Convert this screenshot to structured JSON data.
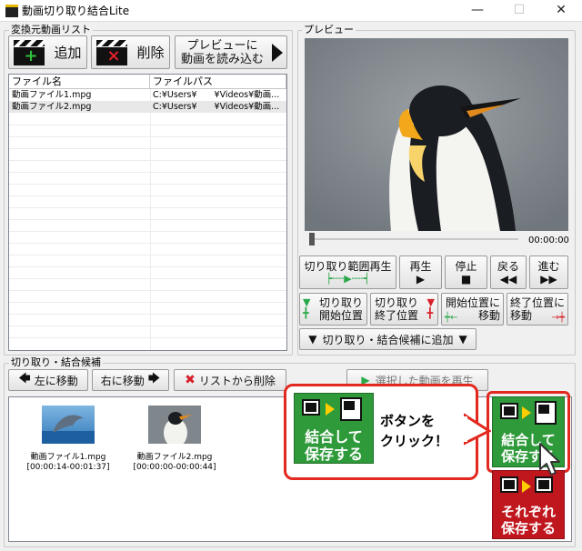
{
  "window": {
    "title": "動画切り取り結合Lite",
    "minimize_icon": "minimize-icon",
    "maximize_icon": "maximize-icon",
    "close_icon": "close-icon"
  },
  "source_list": {
    "group_label": "変換元動画リスト",
    "add_label": "追加",
    "delete_label": "削除",
    "preview_label_line1": "プレビューに",
    "preview_label_line2": "動画を読み込む",
    "columns": [
      "ファイル名",
      "ファイルパス"
    ],
    "rows": [
      {
        "name": "動画ファイル1.mpg",
        "path": "C:¥Users¥　　¥Videos¥動画..."
      },
      {
        "name": "動画ファイル2.mpg",
        "path": "C:¥Users¥　　¥Videos¥動画..."
      }
    ]
  },
  "preview": {
    "group_label": "プレビュー",
    "time": "00:00:00",
    "seek_progress": 0.0,
    "range_play_label": "切り取り範囲再生",
    "play_label": "再生",
    "stop_label": "停止",
    "back_label": "戻る",
    "forward_label": "進む",
    "cut_start_line1": "切り取り",
    "cut_start_line2": "開始位置",
    "cut_end_line1": "切り取り",
    "cut_end_line2": "終了位置",
    "move_start_line1": "開始位置に",
    "move_start_line2": "移動",
    "move_end_line1": "終了位置に",
    "move_end_line2": "移動",
    "add_candidate_label": "切り取り・結合候補に追加"
  },
  "candidates": {
    "group_label": "切り取り・結合候補",
    "move_left_label": "左に移動",
    "move_right_label": "右に移動",
    "remove_label": "リストから削除",
    "play_selected_label": "選択した動画を再生",
    "items": [
      {
        "name": "動画ファイル1.mpg",
        "range": "[00:00:14-00:01:37]"
      },
      {
        "name": "動画ファイル2.mpg",
        "range": "[00:00:00-00:00:44]"
      }
    ]
  },
  "actions": {
    "merge_line1": "結合して",
    "merge_line2": "保存する",
    "separate_line1": "それぞれ",
    "separate_line2": "保存する"
  },
  "callout": {
    "line1": "ボタンを",
    "line2": "クリック！"
  },
  "colors": {
    "accent_red": "#e2281f",
    "merge_green": "#2f9a3a",
    "separate_red": "#c0161e"
  }
}
